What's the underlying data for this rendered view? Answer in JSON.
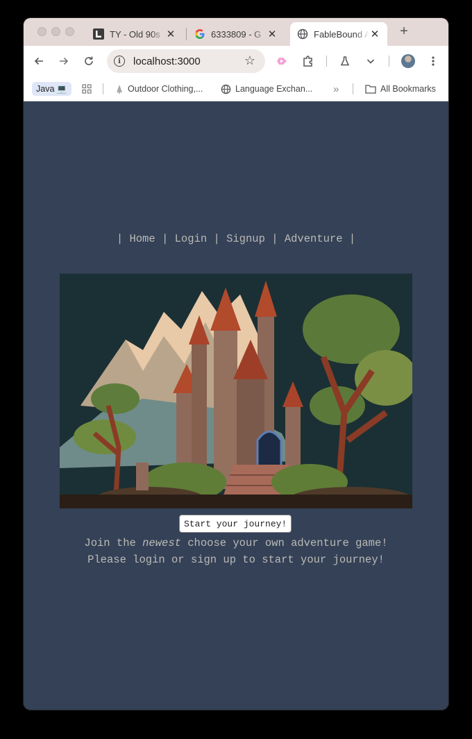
{
  "browser": {
    "tabs": [
      {
        "title": "TY - Old 90s",
        "favicon": "letter-l-icon"
      },
      {
        "title": "6333809 - G",
        "favicon": "google-icon"
      },
      {
        "title": "FableBound A",
        "favicon": "globe-icon",
        "active": true
      }
    ],
    "new_tab_label": "+",
    "address": "localhost:3000",
    "bookmarks": [
      {
        "label": "Java",
        "emoji": "💻"
      },
      {
        "label": "Outdoor Clothing,...",
        "favicon": "tree-icon"
      },
      {
        "label": "Language Exchan...",
        "favicon": "globe-icon"
      }
    ],
    "overflow_label": "»",
    "all_bookmarks_label": "All Bookmarks",
    "colors": {
      "tabstrip": "#e4d9d6",
      "page_bg": "#344157"
    }
  },
  "page": {
    "nav": {
      "sep": "|",
      "items": [
        "Home",
        "Login",
        "Signup",
        "Adventure"
      ]
    },
    "hero_image": {
      "icon": "castle-illustration"
    },
    "cta_label": "Start your journey!",
    "tagline": {
      "line1_before": "Join the ",
      "line1_em": "newest",
      "line1_after": " choose your own adventure game!",
      "line2": "Please login or sign up to start your journey!"
    }
  }
}
